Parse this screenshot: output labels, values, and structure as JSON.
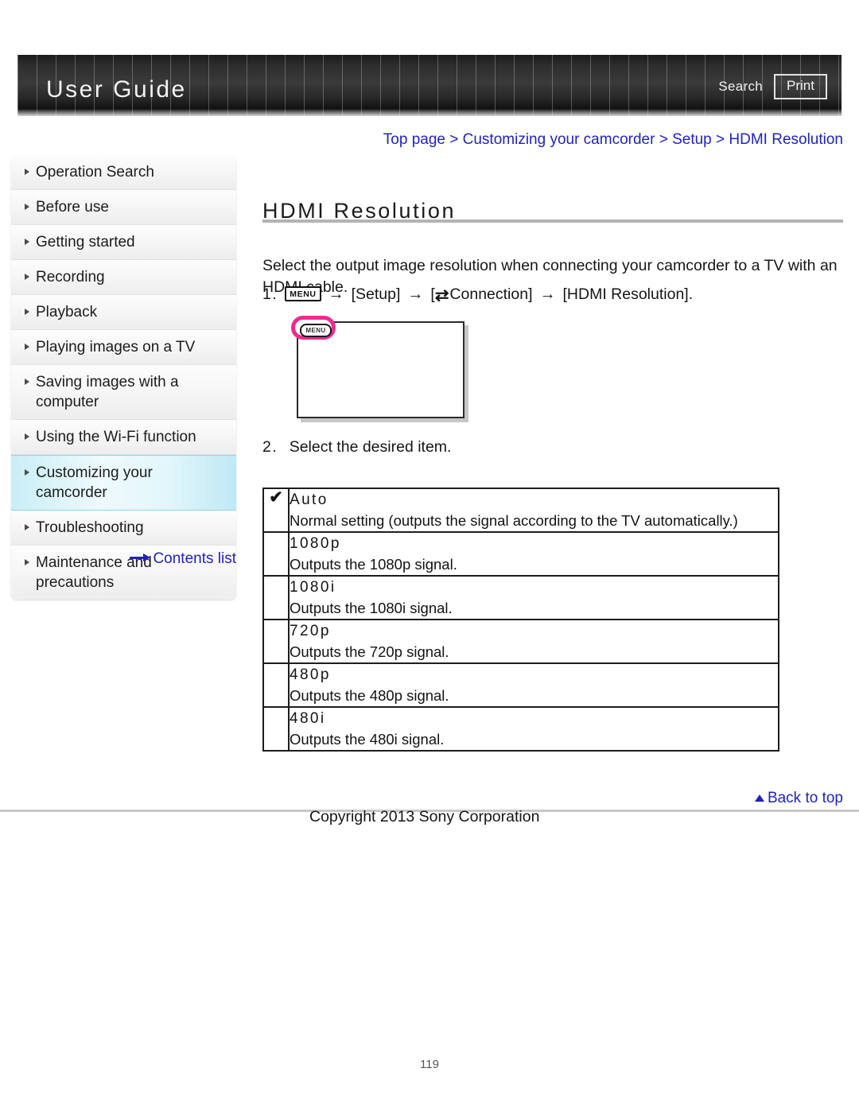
{
  "header": {
    "title": "User Guide",
    "search_label": "Search",
    "print_label": "Print"
  },
  "breadcrumb": {
    "text": "Top page > Customizing your camcorder > Setup > HDMI Resolution"
  },
  "sidebar": {
    "items": [
      {
        "label": "Operation Search",
        "active": false
      },
      {
        "label": "Before use",
        "active": false
      },
      {
        "label": "Getting started",
        "active": false
      },
      {
        "label": "Recording",
        "active": false
      },
      {
        "label": "Playback",
        "active": false
      },
      {
        "label": "Playing images on a TV",
        "active": false
      },
      {
        "label": "Saving images with a computer",
        "active": false
      },
      {
        "label": "Using the Wi-Fi function",
        "active": false
      },
      {
        "label": "Customizing your camcorder",
        "active": true
      },
      {
        "label": "Troubleshooting",
        "active": false
      },
      {
        "label": "Maintenance and precautions",
        "active": false
      }
    ],
    "contents_list_label": "Contents list"
  },
  "main": {
    "title": "HDMI Resolution",
    "intro": "Select the output image resolution when connecting your camcorder to a TV with an HDMI cable.",
    "step1": {
      "number": "1.",
      "menu_icon_label": "MENU",
      "arrow": "→",
      "setup_label": "[Setup]",
      "connection_icon": "⇄",
      "connection_label": "Connection]",
      "connection_open_bracket": "[",
      "target_label": "[HDMI Resolution]."
    },
    "step2": {
      "number": "2.",
      "text": "Select the desired item."
    },
    "screen_mockup": {
      "menu_button_label": "MENU",
      "highlight_color": "#ef2a8e"
    },
    "options": [
      {
        "checked": true,
        "check_glyph": "✔",
        "name": "Auto",
        "desc": "Normal setting (outputs the signal according to the TV automatically.)"
      },
      {
        "checked": false,
        "check_glyph": "",
        "name": "1080p",
        "desc": "Outputs the 1080p signal."
      },
      {
        "checked": false,
        "check_glyph": "",
        "name": "1080i",
        "desc": "Outputs the 1080i signal."
      },
      {
        "checked": false,
        "check_glyph": "",
        "name": "720p",
        "desc": "Outputs the 720p signal."
      },
      {
        "checked": false,
        "check_glyph": "",
        "name": "480p",
        "desc": "Outputs the 480p signal."
      },
      {
        "checked": false,
        "check_glyph": "",
        "name": "480i",
        "desc": "Outputs the 480i signal."
      }
    ]
  },
  "footer": {
    "back_to_top_label": "Back to top",
    "copyright": "Copyright 2013 Sony Corporation",
    "page_number": "119"
  }
}
